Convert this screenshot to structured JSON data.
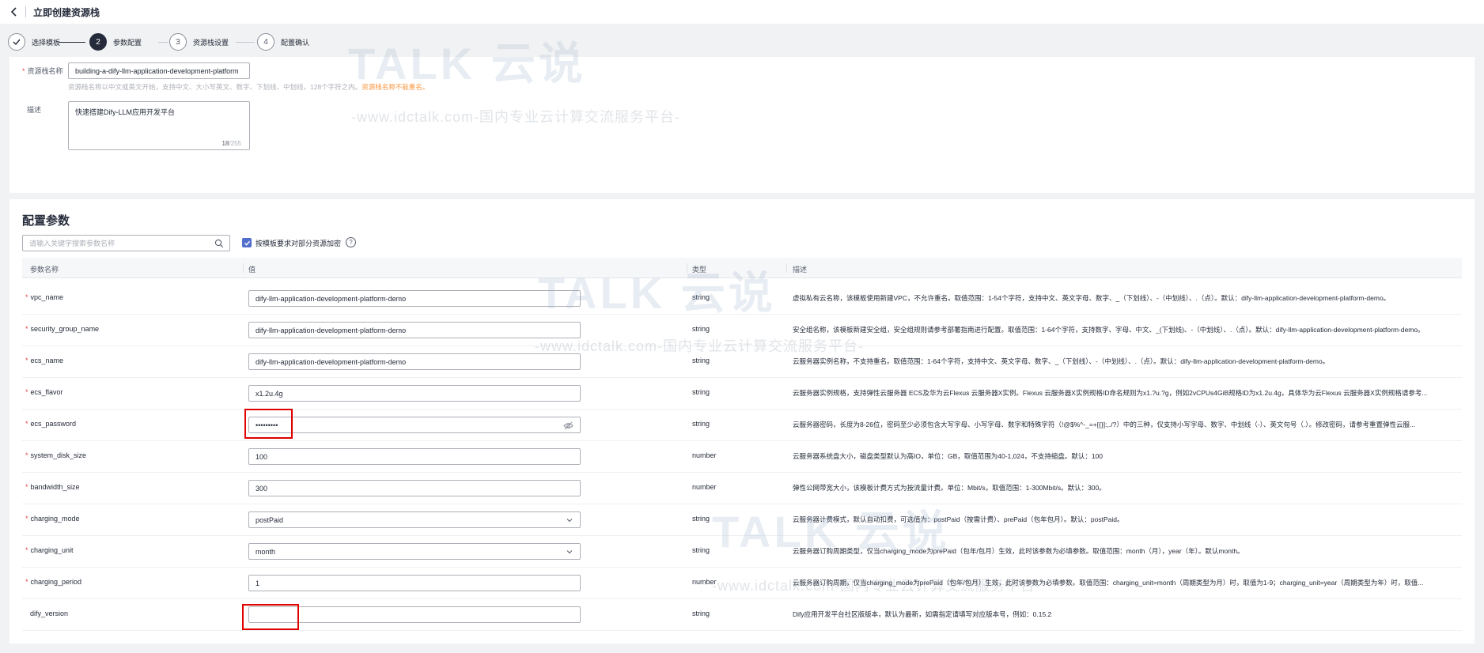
{
  "header": {
    "title": "立即创建资源栈"
  },
  "steps": [
    {
      "number": "1",
      "label": "选择模板"
    },
    {
      "number": "2",
      "label": "参数配置"
    },
    {
      "number": "3",
      "label": "资源栈设置"
    },
    {
      "number": "4",
      "label": "配置确认"
    }
  ],
  "basic": {
    "name_label": "资源栈名称",
    "name_value": "building-a-dify-llm-application-development-platform",
    "name_hint": "资源栈名称以中文或英文开始，支持中文、大小写英文、数字、下划线、中划线，128个字符之内。",
    "name_warn": "资源栈名称不能重名。",
    "desc_label": "描述",
    "desc_value": "快速搭建Dify-LLM应用开发平台",
    "desc_count": "18",
    "desc_max": "/255"
  },
  "params": {
    "title": "配置参数",
    "search_placeholder": "请输入关键字搜索参数名称",
    "encrypt_label": "按模板要求对部分资源加密",
    "help": "?",
    "columns": {
      "name": "参数名称",
      "value": "值",
      "type": "类型",
      "desc": "描述"
    },
    "rows": [
      {
        "name": "vpc_name",
        "required": true,
        "value": "dify-llm-application-development-platform-demo",
        "type": "string",
        "desc": "虚拟私有云名称，该模板使用新建VPC，不允许重名。取值范围：1-54个字符，支持中文、英文字母、数字、_（下划线）、-（中划线）、.（点）。默认：dify-llm-application-development-platform-demo。"
      },
      {
        "name": "security_group_name",
        "required": true,
        "value": "dify-llm-application-development-platform-demo",
        "type": "string",
        "desc": "安全组名称，该模板新建安全组，安全组规则请参考部署指南进行配置。取值范围：1-64个字符，支持数字、字母、中文、_(下划线)、-（中划线）、.（点）。默认：dify-llm-application-development-platform-demo。"
      },
      {
        "name": "ecs_name",
        "required": true,
        "value": "dify-llm-application-development-platform-demo",
        "type": "string",
        "desc": "云服务器实例名称，不支持重名。取值范围：1-64个字符，支持中文、英文字母、数字、_（下划线）、-（中划线）、.（点）。默认：dify-llm-application-development-platform-demo。"
      },
      {
        "name": "ecs_flavor",
        "required": true,
        "value": "x1.2u.4g",
        "type": "string",
        "desc": "云服务器实例规格，支持弹性云服务器 ECS及华为云Flexus 云服务器X实例。Flexus 云服务器X实例规格ID命名规则为x1.?u.?g，例如2vCPUs4GiB规格ID为x1.2u.4g，具体华为云Flexus 云服务器X实例规格请参考..."
      },
      {
        "name": "ecs_password",
        "required": true,
        "value": "•••••••••",
        "type": "string",
        "desc": "云服务器密码，长度为8-26位，密码至少必须包含大写字母、小写字母、数字和特殊字符（!@$%^-_=+[{}]:,./?）中的三种，仅支持小写字母、数字、中划线（-）、英文句号（.）。修改密码，请参考重置弹性云服..."
      },
      {
        "name": "system_disk_size",
        "required": true,
        "value": "100",
        "type": "number",
        "desc": "云服务器系统盘大小，磁盘类型默认为高IO，单位：GB，取值范围为40-1,024，不支持缩盘。默认：100"
      },
      {
        "name": "bandwidth_size",
        "required": true,
        "value": "300",
        "type": "number",
        "desc": "弹性公网带宽大小，该模板计费方式为按流量计费。单位：Mbit/s，取值范围：1-300Mbit/s。默认：300。"
      },
      {
        "name": "charging_mode",
        "required": true,
        "value": "postPaid",
        "type": "string",
        "desc": "云服务器计费模式，默认自动扣费，可选值为：postPaid（按需计费）、prePaid（包年包月）。默认：postPaid。"
      },
      {
        "name": "charging_unit",
        "required": true,
        "value": "month",
        "type": "string",
        "desc": "云服务器订购周期类型，仅当charging_mode为prePaid（包年/包月）生效，此时该参数为必填参数。取值范围：month（月），year（年）。默认month。"
      },
      {
        "name": "charging_period",
        "required": true,
        "value": "1",
        "type": "number",
        "desc": "云服务器订购周期，仅当charging_mode为prePaid（包年/包月）生效，此时该参数为必填参数。取值范围：charging_unit=month（周期类型为月）时，取值为1-9；charging_unit=year（周期类型为年）时，取值..."
      },
      {
        "name": "dify_version",
        "required": false,
        "value": "",
        "type": "string",
        "desc": "Dify应用开发平台社区版版本，默认为最新，如需指定请填写对应版本号，例如：0.15.2"
      }
    ]
  },
  "watermark": {
    "brand": "TALK 云说",
    "url": "-www.idctalk.com-国内专业云计算交流服务平台-"
  },
  "colors": {
    "accent": "#526ecc",
    "highlight_box": "#e00000",
    "required": "#e54545",
    "warning": "#fa9841"
  }
}
